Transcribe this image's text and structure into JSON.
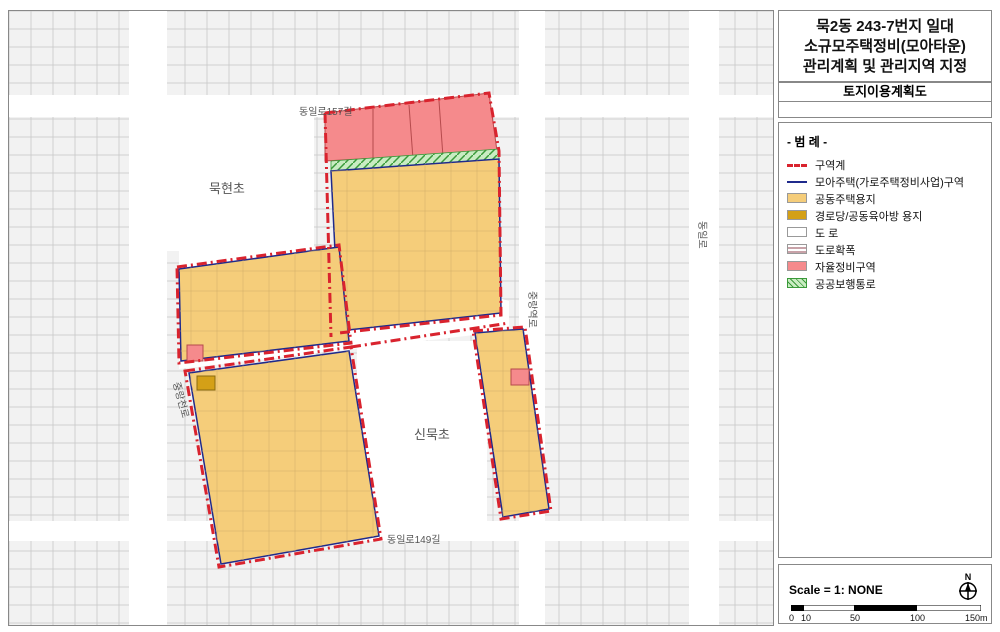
{
  "title": {
    "line1": "묵2동 243-7번지 일대",
    "line2": "소규모주택정비(모아타운)",
    "line3": "관리계획 및 관리지역 지정"
  },
  "subtitle": "토지이용계획도",
  "legend": {
    "title": "- 범 례 -",
    "items": [
      {
        "label": "구역계",
        "swatch": "boundary",
        "color": "#d9232e"
      },
      {
        "label": "모아주택(가로주택정비사업)구역",
        "swatch": "blue-line",
        "color": "#1f2a8c"
      },
      {
        "label": "공동주택용지",
        "swatch": "fill",
        "color": "#f5cd7a"
      },
      {
        "label": "경로당/공동육아방 용지",
        "swatch": "fill",
        "color": "#d4a017"
      },
      {
        "label": "도    로",
        "swatch": "fill",
        "color": "#ffffff"
      },
      {
        "label": "도로확폭",
        "swatch": "road-widen",
        "color": "#c8a2a8"
      },
      {
        "label": "자율정비구역",
        "swatch": "fill",
        "color": "#f58a8c"
      },
      {
        "label": "공공보행통로",
        "swatch": "pedestrian",
        "color": "#5cb85c"
      }
    ]
  },
  "map_labels": {
    "school1": "묵현초",
    "school2": "신묵초",
    "road_top": "동일로157길",
    "road_bottom": "동일로149길",
    "road_right": "동일로",
    "road_mid": "중랑역로",
    "road_left": "중랑천로"
  },
  "scale": {
    "label": "Scale = 1: NONE",
    "north": "N",
    "ticks": [
      "0",
      "10",
      "50",
      "100",
      "150m"
    ]
  },
  "colors": {
    "boundary": "#d9232e",
    "residential": "#f5cd7a",
    "self_maintenance": "#f58a8c",
    "senior_center": "#d4a017",
    "moa_line": "#1f2a8c",
    "pedestrian": "#5cb85c"
  }
}
